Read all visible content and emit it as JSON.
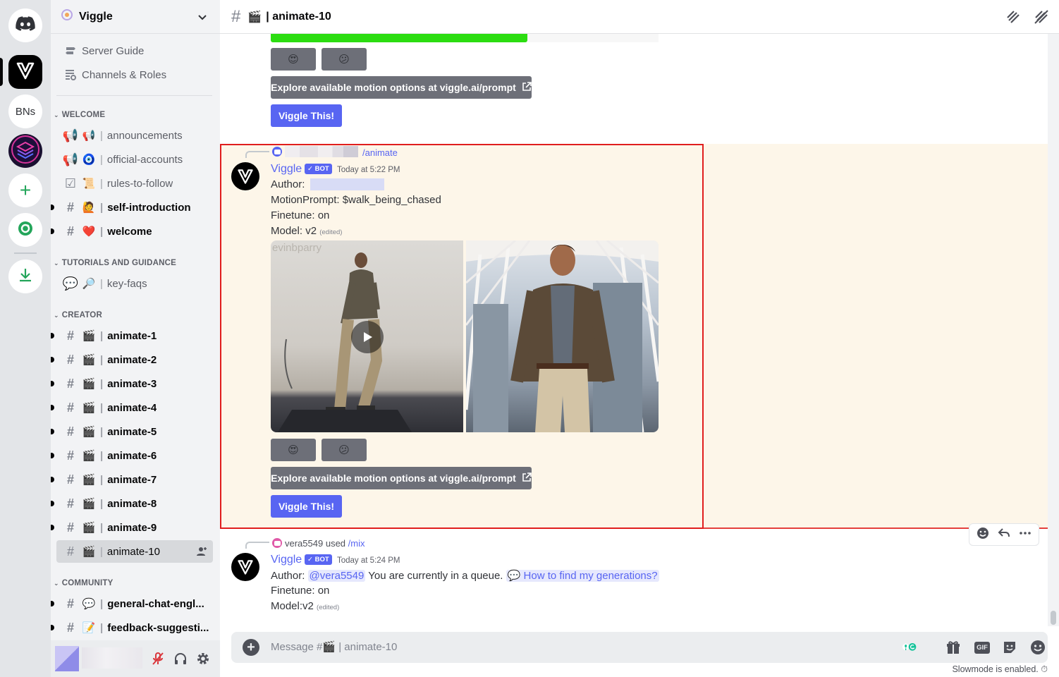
{
  "server_rail": {
    "home_icon": "discord-logo-icon",
    "servers": [
      {
        "name": "viggle-server",
        "label": ""
      },
      {
        "name": "bns-server",
        "label": "BNs"
      },
      {
        "name": "layers-server",
        "label": ""
      }
    ],
    "add_icon": "plus-icon",
    "discover_icon": "compass-icon",
    "download_icon": "download-icon"
  },
  "sidebar": {
    "guild_name": "Viggle",
    "top_items": [
      {
        "label": "Server Guide",
        "icon": "signpost-icon"
      },
      {
        "label": "Channels & Roles",
        "icon": "list-icon"
      }
    ],
    "categories": [
      {
        "label": "WELCOME"
      },
      {
        "label": "TUTORIALS AND GUIDANCE"
      },
      {
        "label": "CREATOR"
      },
      {
        "label": "COMMUNITY"
      }
    ],
    "channels": [
      {
        "emoji": "📢",
        "name": "announcements"
      },
      {
        "emoji": "🧿",
        "name": "official-accounts"
      },
      {
        "emoji": "📜",
        "name": "rules-to-follow"
      },
      {
        "emoji": "🙋",
        "name": "self-introduction"
      },
      {
        "emoji": "❤️",
        "name": "welcome"
      },
      {
        "emoji": "🔎",
        "name": "key-faqs"
      },
      {
        "emoji": "🎬",
        "name": "animate-1"
      },
      {
        "emoji": "🎬",
        "name": "animate-2"
      },
      {
        "emoji": "🎬",
        "name": "animate-3"
      },
      {
        "emoji": "🎬",
        "name": "animate-4"
      },
      {
        "emoji": "🎬",
        "name": "animate-5"
      },
      {
        "emoji": "🎬",
        "name": "animate-6"
      },
      {
        "emoji": "🎬",
        "name": "animate-7"
      },
      {
        "emoji": "🎬",
        "name": "animate-8"
      },
      {
        "emoji": "🎬",
        "name": "animate-9"
      },
      {
        "emoji": "🎬",
        "name": "animate-10"
      },
      {
        "emoji": "💬",
        "name": "general-chat-engl..."
      },
      {
        "emoji": "📝",
        "name": "feedback-suggesti..."
      }
    ],
    "separator": "|"
  },
  "chat": {
    "header_emoji": "🎬",
    "header_title": "| animate-10",
    "reactions": [
      "😍",
      "😕"
    ],
    "explore_button": "Explore available motion options at viggle.ai/prompt",
    "viggle_button": "Viggle This!",
    "messages": [
      {
        "command": "/animate",
        "username": "Viggle",
        "badge": "✓ BOT",
        "timestamp": "Today at 5:22 PM",
        "author_label": "Author:",
        "motion_prompt": "MotionPrompt: $walk_being_chased",
        "finetune": "Finetune: on",
        "model": "Model: v2",
        "edited": "(edited)",
        "watermark": "evinbparry"
      },
      {
        "reply_user": "vera5549",
        "reply_used": "used",
        "command": "/mix",
        "username": "Viggle",
        "badge": "✓ BOT",
        "timestamp": "Today at 5:24 PM",
        "author_label": "Author:",
        "mention": "@vera5549",
        "queue_text": "You are currently in a queue.",
        "link_text": "How to find my generations?",
        "finetune": "Finetune: on",
        "model": "Model:v2",
        "edited": "(edited)"
      }
    ],
    "composer": {
      "placeholder_prefix": "Message #",
      "placeholder_emoji": "🎬",
      "placeholder_channel": "| animate-10",
      "gif": "GIF"
    },
    "slowmode": "Slowmode is enabled."
  },
  "colors": {
    "highlight_bg": "#fdf6e9",
    "highlight_border": "#e01e1e",
    "blurple": "#5865f2",
    "green_bar": "#2cdd11"
  }
}
